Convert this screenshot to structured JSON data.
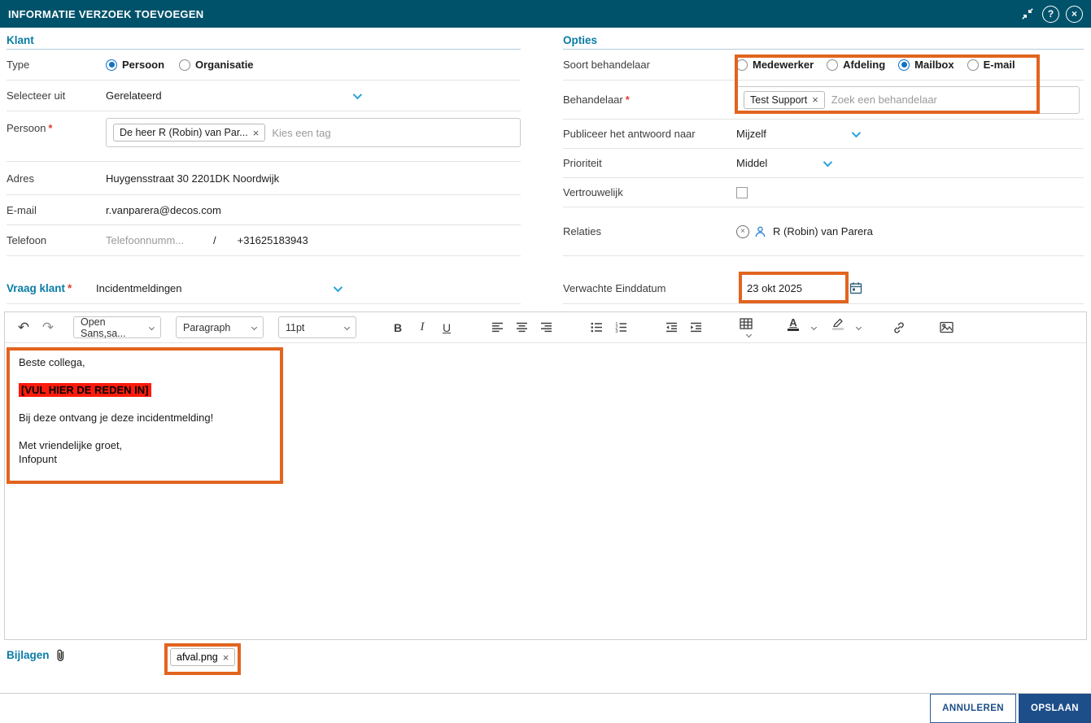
{
  "header": {
    "title": "INFORMATIE VERZOEK TOEVOEGEN",
    "help_glyph": "?",
    "close_glyph": "×"
  },
  "klant": {
    "heading": "Klant",
    "type": {
      "label": "Type",
      "options": [
        {
          "label": "Persoon",
          "selected": true
        },
        {
          "label": "Organisatie",
          "selected": false
        }
      ]
    },
    "selecteer_uit": {
      "label": "Selecteer uit",
      "value": "Gerelateerd"
    },
    "persoon": {
      "label": "Persoon",
      "required_mark": "*",
      "chip": "De heer R (Robin) van Par...",
      "chip_remove_glyph": "×",
      "placeholder": "Kies een tag"
    },
    "adres": {
      "label": "Adres",
      "value": "Huygensstraat 30 2201DK Noordwijk"
    },
    "email": {
      "label": "E-mail",
      "value": "r.vanparera@decos.com"
    },
    "telefoon": {
      "label": "Telefoon",
      "placeholder": "Telefoonnumm...",
      "separator": "/",
      "value": "+31625183943"
    },
    "vraag": {
      "label": "Vraag klant",
      "required_mark": "*",
      "value": "Incidentmeldingen"
    }
  },
  "opties": {
    "heading": "Opties",
    "soort": {
      "label": "Soort behandelaar",
      "options": [
        {
          "label": "Medewerker",
          "selected": false
        },
        {
          "label": "Afdeling",
          "selected": false
        },
        {
          "label": "Mailbox",
          "selected": true
        },
        {
          "label": "E-mail",
          "selected": false
        }
      ]
    },
    "behandelaar": {
      "label": "Behandelaar",
      "required_mark": "*",
      "chip": "Test Support",
      "chip_remove_glyph": "×",
      "placeholder": "Zoek een behandelaar"
    },
    "publiceer": {
      "label": "Publiceer het antwoord naar",
      "value": "Mijzelf"
    },
    "prioriteit": {
      "label": "Prioriteit",
      "value": "Middel"
    },
    "vertrouwelijk": {
      "label": "Vertrouwelijk",
      "checked": false
    },
    "relaties": {
      "label": "Relaties",
      "value": "R (Robin) van Parera",
      "remove_glyph": "×"
    },
    "einddatum": {
      "label": "Verwachte Einddatum",
      "value": "23 okt 2025"
    }
  },
  "editor": {
    "toolbar": {
      "undo_glyph": "↶",
      "redo_glyph": "↷",
      "font": "Open Sans,sa...",
      "block": "Paragraph",
      "size": "11pt",
      "bold": "B",
      "italic": "I",
      "underline": "U"
    },
    "content": {
      "greeting": "Beste collega,",
      "highlighted": "[VUL HIER DE REDEN IN]",
      "body": "Bij deze ontvang je deze incidentmelding!",
      "closing": "Met vriendelijke groet,",
      "signature": "Infopunt"
    }
  },
  "bijlagen": {
    "label": "Bijlagen",
    "chip": "afval.png",
    "chip_remove_glyph": "×"
  },
  "footer": {
    "cancel": "ANNULEREN",
    "save": "OPSLAAN"
  },
  "colors": {
    "header_bg": "#00526b",
    "accent": "#0a7ca6",
    "annotation": "#e2641f",
    "highlight_bg": "#fe1b0c",
    "primary_button": "#1d4e89"
  }
}
